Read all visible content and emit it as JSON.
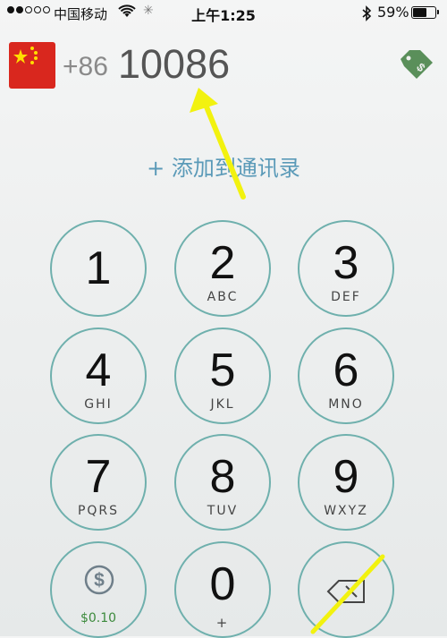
{
  "status_bar": {
    "carrier": "中国移动",
    "time": "上午1:25",
    "battery": "59%",
    "battery_level": 0.59
  },
  "header": {
    "country_code": "+86",
    "dialed_number": "10086"
  },
  "add_contact": "+ 添加到通讯录",
  "keypad": [
    {
      "digit": "1",
      "letters": ""
    },
    {
      "digit": "2",
      "letters": "ABC"
    },
    {
      "digit": "3",
      "letters": "DEF"
    },
    {
      "digit": "4",
      "letters": "GHI"
    },
    {
      "digit": "5",
      "letters": "JKL"
    },
    {
      "digit": "6",
      "letters": "MNO"
    },
    {
      "digit": "7",
      "letters": "PQRS"
    },
    {
      "digit": "8",
      "letters": "TUV"
    },
    {
      "digit": "9",
      "letters": "WXYZ"
    }
  ],
  "bottom_row": {
    "credit": "$0.10",
    "zero_digit": "0",
    "zero_sub": "+"
  },
  "colors": {
    "ring": "#6fb0ad",
    "link": "#5a9ab8",
    "tag": "#5a8f5a",
    "credit": "#3c8a3c",
    "annotation": "#f2f20f"
  },
  "icons": [
    "china-flag-icon",
    "price-tag-icon",
    "dollar-icon",
    "backspace-icon",
    "wifi-icon",
    "bluetooth-icon"
  ]
}
